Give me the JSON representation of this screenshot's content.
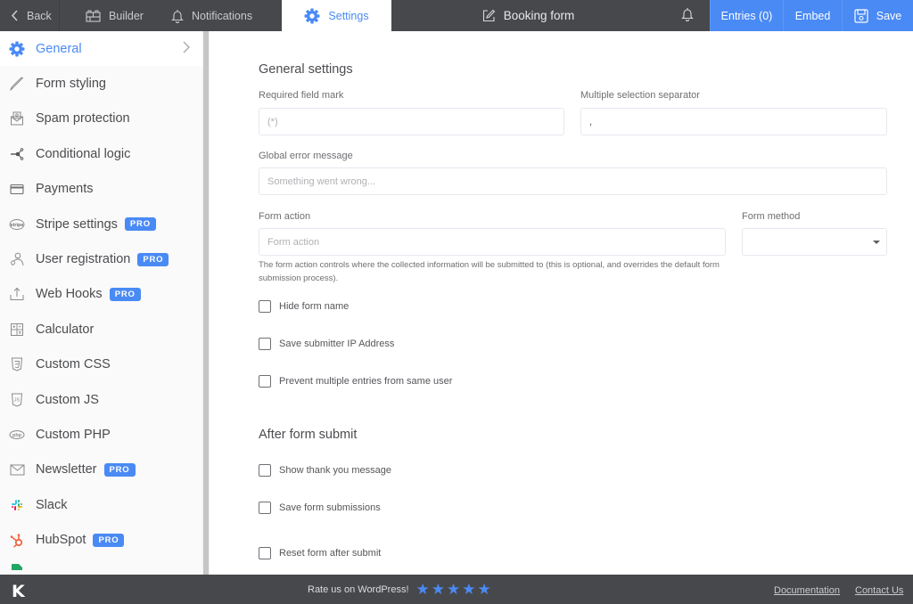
{
  "topbar": {
    "back": "Back",
    "builder": "Builder",
    "notifications": "Notifications",
    "settings": "Settings",
    "form_title": "Booking form",
    "entries": "Entries (0)",
    "embed": "Embed",
    "save": "Save"
  },
  "sidebar": {
    "items": [
      {
        "label": "General",
        "icon": "gear-icon",
        "active": true,
        "pro": false
      },
      {
        "label": "Form styling",
        "icon": "brush-icon",
        "pro": false
      },
      {
        "label": "Spam protection",
        "icon": "spam-envelope-icon",
        "pro": false
      },
      {
        "label": "Conditional logic",
        "icon": "logic-branch-icon",
        "pro": false
      },
      {
        "label": "Payments",
        "icon": "credit-card-icon",
        "pro": false
      },
      {
        "label": "Stripe settings",
        "icon": "stripe-icon",
        "pro": true
      },
      {
        "label": "User registration",
        "icon": "user-icon",
        "pro": true
      },
      {
        "label": "Web Hooks",
        "icon": "upload-icon",
        "pro": true
      },
      {
        "label": "Calculator",
        "icon": "calculator-icon",
        "pro": false
      },
      {
        "label": "Custom CSS",
        "icon": "css-icon",
        "pro": false
      },
      {
        "label": "Custom JS",
        "icon": "js-icon",
        "pro": false
      },
      {
        "label": "Custom PHP",
        "icon": "php-icon",
        "pro": false
      },
      {
        "label": "Newsletter",
        "icon": "envelope-icon",
        "pro": true
      },
      {
        "label": "Slack",
        "icon": "slack-icon",
        "pro": false
      },
      {
        "label": "HubSpot",
        "icon": "hubspot-icon",
        "pro": true
      }
    ],
    "pro_label": "PRO"
  },
  "general": {
    "heading": "General settings",
    "required_mark_label": "Required field mark",
    "required_mark_placeholder": "(*)",
    "separator_label": "Multiple selection separator",
    "separator_value": ",",
    "error_label": "Global error message",
    "error_placeholder": "Something went wrong...",
    "action_label": "Form action",
    "action_placeholder": "Form action",
    "method_label": "Form method",
    "method_value": "",
    "action_help": "The form action controls where the collected information will be submitted to (this is optional, and overrides the default form submission process).",
    "checkboxes": [
      {
        "label": "Hide form name",
        "checked": false
      },
      {
        "label": "Save submitter IP Address",
        "checked": false
      },
      {
        "label": "Prevent multiple entries from same user",
        "checked": false
      }
    ]
  },
  "after_submit": {
    "heading": "After form submit",
    "checkboxes": [
      {
        "label": "Show thank you message",
        "checked": false
      },
      {
        "label": "Save form submissions",
        "checked": false
      },
      {
        "label": "Reset form after submit",
        "checked": false
      }
    ]
  },
  "footer": {
    "logo": "K",
    "rate_text": "Rate us on WordPress!",
    "stars": 5,
    "documentation": "Documentation",
    "contact": "Contact Us"
  },
  "colors": {
    "accent": "#4a8af4",
    "topbar_bg": "#47484b",
    "sidebar_bg": "#fafafa"
  }
}
